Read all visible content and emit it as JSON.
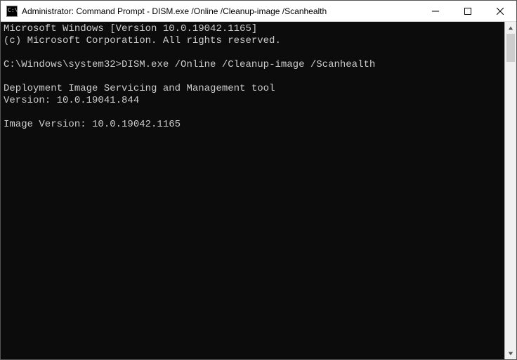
{
  "titlebar": {
    "title": "Administrator: Command Prompt - DISM.exe  /Online /Cleanup-image /Scanhealth"
  },
  "console": {
    "header_line1": "Microsoft Windows [Version 10.0.19042.1165]",
    "header_line2": "(c) Microsoft Corporation. All rights reserved.",
    "prompt_path": "C:\\Windows\\system32>",
    "command": "DISM.exe /Online /Cleanup-image /Scanhealth",
    "tool_line1": "Deployment Image Servicing and Management tool",
    "tool_line2": "Version: 10.0.19041.844",
    "image_version_line": "Image Version: 10.0.19042.1165"
  }
}
